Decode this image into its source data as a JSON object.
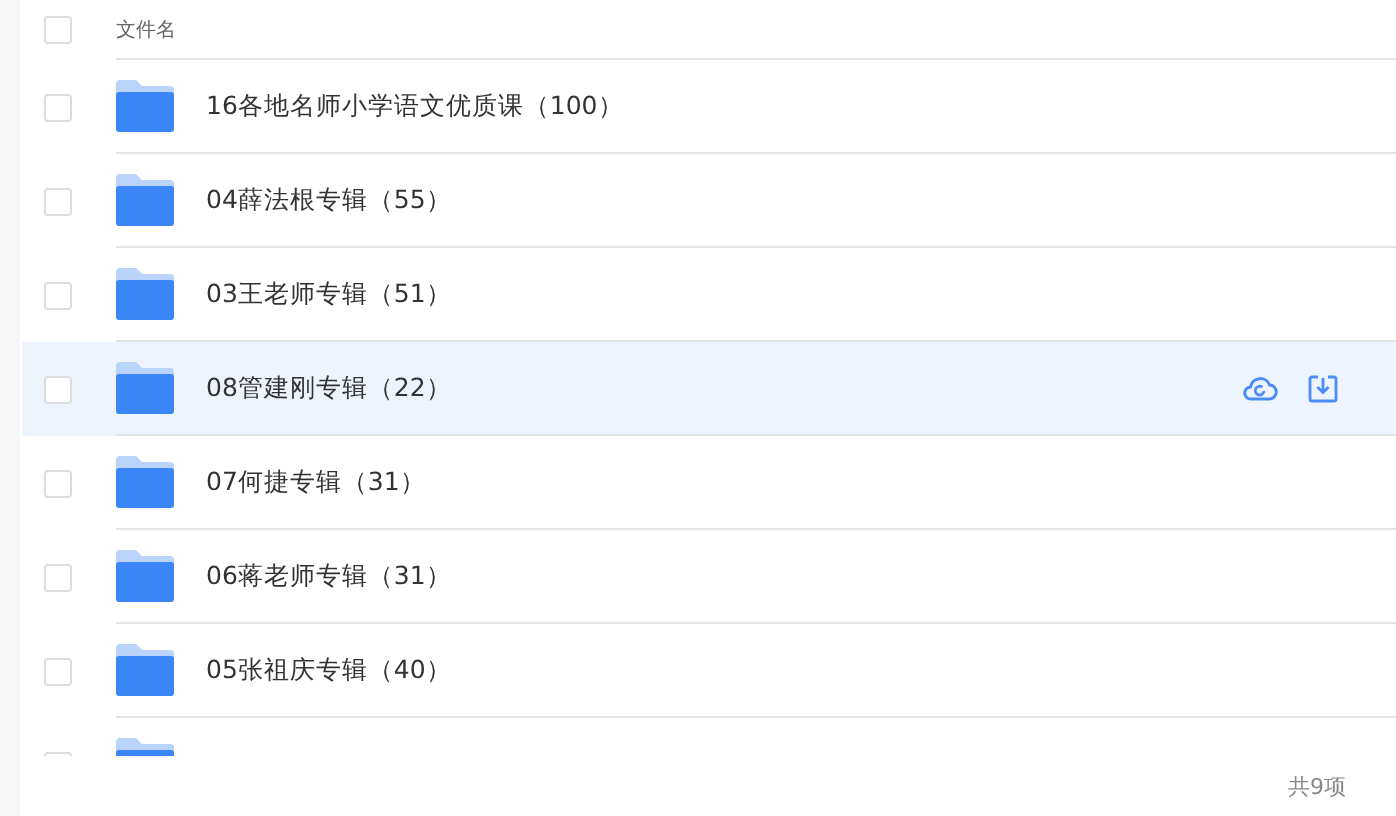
{
  "header": {
    "checked": false,
    "label": "文件名"
  },
  "rows": [
    {
      "name": "16各地名师小学语文优质课（100）",
      "checked": false,
      "hovered": false
    },
    {
      "name": "04薛法根专辑（55）",
      "checked": false,
      "hovered": false
    },
    {
      "name": "03王老师专辑（51）",
      "checked": false,
      "hovered": false
    },
    {
      "name": "08管建刚专辑（22）",
      "checked": false,
      "hovered": true
    },
    {
      "name": "07何捷专辑（31）",
      "checked": false,
      "hovered": false
    },
    {
      "name": "06蒋老师专辑（31）",
      "checked": false,
      "hovered": false
    },
    {
      "name": "05张祖庆专辑（40）",
      "checked": false,
      "hovered": false
    },
    {
      "checked": false,
      "hovered": false
    }
  ],
  "footer": {
    "count": "共9项"
  }
}
